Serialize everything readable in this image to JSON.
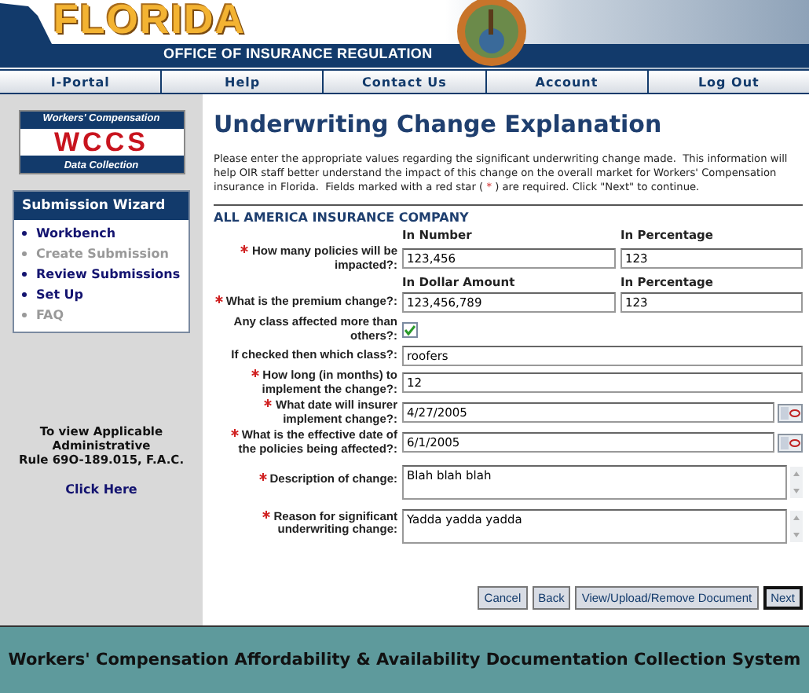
{
  "header": {
    "state_name": "FLORIDA",
    "office": "OFFICE OF INSURANCE REGULATION"
  },
  "nav": [
    {
      "label": "I-Portal"
    },
    {
      "label": "Help"
    },
    {
      "label": "Contact Us"
    },
    {
      "label": "Account"
    },
    {
      "label": "Log Out"
    }
  ],
  "sidebar": {
    "logo": {
      "top": "Workers' Compensation",
      "main": "WCCS",
      "bottom": "Data Collection"
    },
    "wizard": {
      "title": "Submission Wizard",
      "items": [
        {
          "label": "Workbench",
          "disabled": false
        },
        {
          "label": "Create Submission",
          "disabled": true
        },
        {
          "label": "Review Submissions",
          "disabled": false
        },
        {
          "label": "Set Up",
          "disabled": false
        },
        {
          "label": "FAQ",
          "disabled": true
        }
      ]
    },
    "rule_note": [
      "To view Applicable",
      "Administrative",
      "Rule 69O-189.015, F.A.C."
    ],
    "rule_link": "Click Here"
  },
  "main": {
    "title": "Underwriting Change Explanation",
    "intro": {
      "before": "Please enter the appropriate values regarding the significant underwriting change made.  This information will help OIR staff better understand the impact of this change on the overall market for Workers' Compensation insurance in Florida.  Fields marked with a red star (",
      "mark": "*",
      "after": ") are required. Click \"Next\" to continue."
    },
    "company": "ALL AMERICA INSURANCE COMPANY",
    "rows": [
      {
        "kind": "pair",
        "headings": [
          "In Number",
          "In Percentage"
        ],
        "required": true,
        "label": "How many policies will be impacted?:",
        "values": [
          "123,456",
          "123"
        ]
      },
      {
        "kind": "pair",
        "headings": [
          "In Dollar Amount",
          "In Percentage"
        ],
        "required": true,
        "label": "What is the premium change?:",
        "values": [
          "123,456,789",
          "123"
        ]
      },
      {
        "kind": "checkbox",
        "required": false,
        "label": "Any class affected more than others?:",
        "checked": true
      },
      {
        "kind": "text",
        "required": false,
        "label": "If checked then which class?:",
        "value": "roofers"
      },
      {
        "kind": "text",
        "required": true,
        "label": "How long (in months) to implement the change?:",
        "value": "12"
      },
      {
        "kind": "date",
        "required": true,
        "label": "What date will insurer implement change?:",
        "value": "4/27/2005"
      },
      {
        "kind": "date",
        "required": true,
        "label": "What is the effective date of the policies being affected?:",
        "value": "6/1/2005"
      },
      {
        "kind": "textarea",
        "required": true,
        "label": "Description of change:",
        "value": "Blah blah blah"
      },
      {
        "kind": "textarea",
        "required": true,
        "label": "Reason for significant underwriting change:",
        "value": "Yadda yadda yadda"
      }
    ],
    "buttons": [
      {
        "label": "Cancel",
        "default": false
      },
      {
        "label": "Back",
        "default": false
      },
      {
        "label": "View/Upload/Remove Document",
        "default": false
      },
      {
        "label": "Next",
        "default": true
      }
    ]
  },
  "footer": "Workers' Compensation Affordability & Availability Documentation Collection System"
}
